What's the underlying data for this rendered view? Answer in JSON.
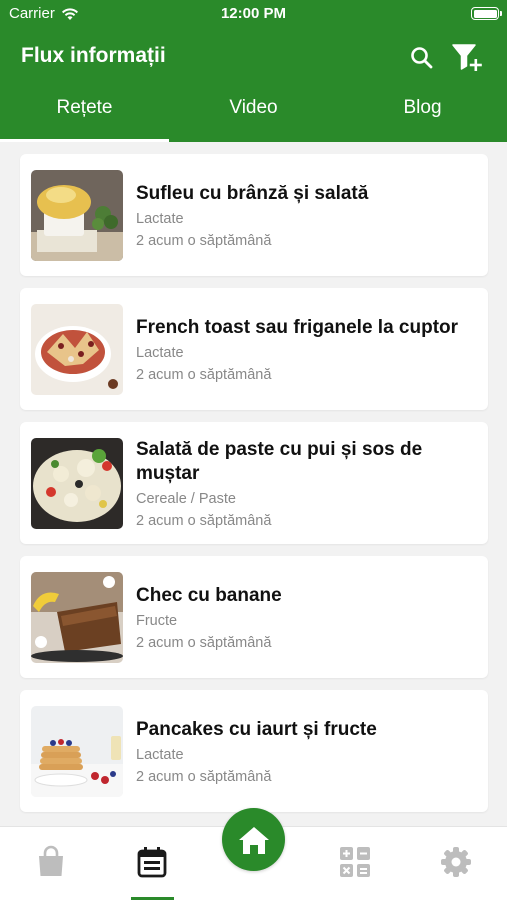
{
  "status_bar": {
    "carrier": "Carrier",
    "time": "12:00 PM"
  },
  "header": {
    "title": "Flux informații"
  },
  "tabs": [
    {
      "label": "Rețete",
      "active": true
    },
    {
      "label": "Video",
      "active": false
    },
    {
      "label": "Blog",
      "active": false
    }
  ],
  "recipes": [
    {
      "title": "Sufleu cu brânză și salată",
      "category": "Lactate",
      "time": "2 acum o săptămână",
      "image": "souffle"
    },
    {
      "title": "French toast sau friganele la cuptor",
      "category": "Lactate",
      "time": "2 acum o săptămână",
      "image": "french-toast"
    },
    {
      "title": "Salată de paste cu pui și sos de muștar",
      "category": "Cereale / Paste",
      "time": "2 acum o săptămână",
      "image": "pasta-salad"
    },
    {
      "title": "Chec cu banane",
      "category": "Fructe",
      "time": "2 acum o săptămână",
      "image": "banana-bread"
    },
    {
      "title": "Pancakes cu iaurt și fructe",
      "category": "Lactate",
      "time": "2 acum o săptămână",
      "image": "pancakes"
    }
  ],
  "bottom_nav": {
    "items": [
      "shop-icon",
      "calendar-icon",
      "home-icon",
      "calculator-icon",
      "settings-icon"
    ],
    "active": "calendar-icon"
  },
  "colors": {
    "brand": "#2a8a2a",
    "background": "#f2f2f2",
    "muted_text": "#888888",
    "inactive_icon": "#bdbdbd"
  }
}
